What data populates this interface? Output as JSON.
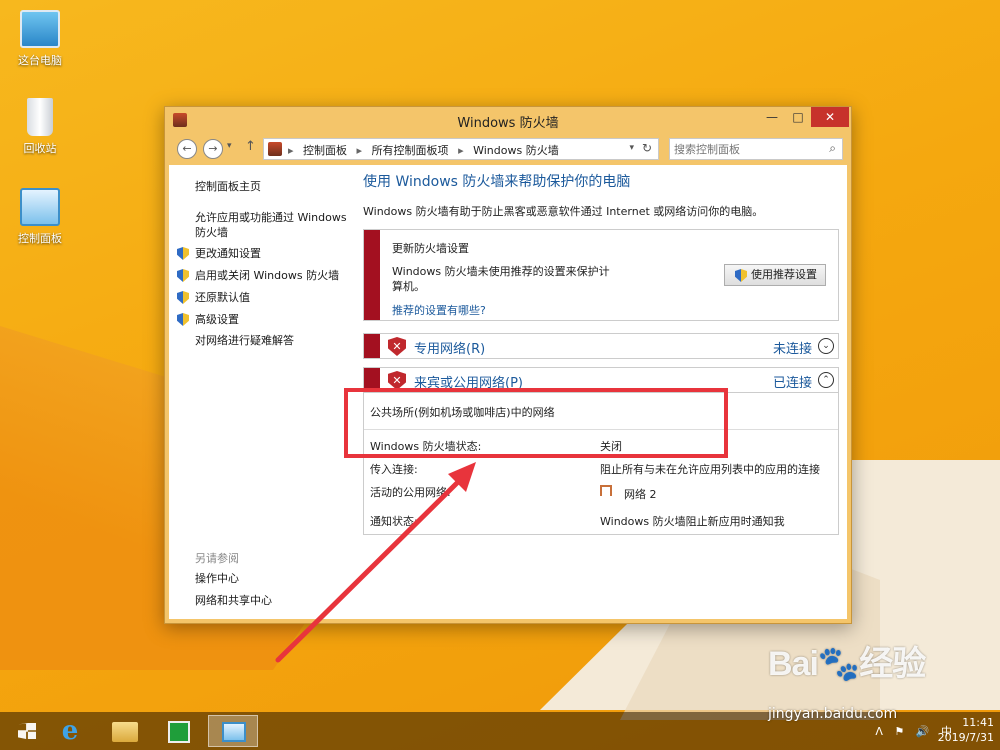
{
  "desktop": {
    "icons": [
      {
        "label": "这台电脑"
      },
      {
        "label": "回收站"
      },
      {
        "label": "控制面板"
      }
    ]
  },
  "window": {
    "title": "Windows 防火墙",
    "controls": {
      "minimize": "—",
      "maximize": "□",
      "close": "✕"
    }
  },
  "toolbar": {
    "back": "←",
    "forward": "→",
    "recent": "▾",
    "up": "↑",
    "breadcrumbs": [
      "控制面板",
      "所有控制面板项",
      "Windows 防火墙"
    ],
    "separator": "▸",
    "address_drop": "▾",
    "refresh": "↻",
    "search_placeholder": "搜索控制面板",
    "search_icon": "⌕"
  },
  "sidebar": {
    "home": "控制面板主页",
    "allow_app_line1": "允许应用或功能通过 Windows",
    "allow_app_line2": "防火墙",
    "change_notify": "更改通知设置",
    "toggle_firewall": "启用或关闭 Windows 防火墙",
    "restore_defaults": "还原默认值",
    "advanced": "高级设置",
    "troubleshoot": "对网络进行疑难解答",
    "see_also": "另请参阅",
    "action_center": "操作中心",
    "network_sharing": "网络和共享中心"
  },
  "main": {
    "title": "使用 Windows 防火墙来帮助保护你的电脑",
    "description": "Windows 防火墙有助于防止黑客或恶意软件通过 Internet 或网络访问你的电脑。",
    "update": {
      "title": "更新防火墙设置",
      "desc_line1": "Windows 防火墙未使用推荐的设置来保护计",
      "desc_line2": "算机。",
      "link": "推荐的设置有哪些?",
      "button": "使用推荐设置"
    },
    "private_network": {
      "name": "专用网络(R)",
      "status": "未连接",
      "chevron": "⌄"
    },
    "public_network": {
      "name": "来宾或公用网络(P)",
      "status": "已连接",
      "chevron": "⌃"
    },
    "details": {
      "network_desc": "公共场所(例如机场或咖啡店)中的网络",
      "state_label": "Windows 防火墙状态:",
      "state_value": "关闭",
      "incoming_label": "传入连接:",
      "incoming_value": "阻止所有与未在允许应用列表中的应用的连接",
      "active_label": "活动的公用网络:",
      "active_value": "网络  2",
      "notify_label": "通知状态:",
      "notify_value": "Windows 防火墙阻止新应用时通知我"
    }
  },
  "taskbar": {
    "ie_glyph": "e",
    "tray": [
      "ᐱ",
      "⚑",
      "🔊",
      "中"
    ],
    "time": "11:41",
    "date": "2019/7/31"
  },
  "watermark": {
    "logo": "Bai🐾经验",
    "url": "jingyan.baidu.com"
  },
  "colors": {
    "accent_blue": "#1c5a9c",
    "alert_red": "#a31020",
    "highlight_red": "#e8343c",
    "desktop_orange": "#f5a80f"
  }
}
